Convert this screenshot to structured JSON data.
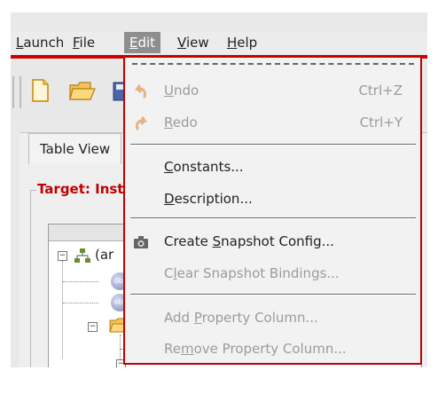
{
  "menubar": {
    "launch": "Launch",
    "file": "File",
    "edit": "Edit",
    "view": "View",
    "help": "Help"
  },
  "tabs": {
    "table_view": "Table View"
  },
  "target": {
    "title": "Target: Inst"
  },
  "tree": {
    "root_label": "(ar",
    "obj_badge": "obj"
  },
  "edit_menu": {
    "undo": {
      "label": "Undo",
      "accel": "Ctrl+Z",
      "enabled": false,
      "icon": "undo-arrow-icon"
    },
    "redo": {
      "label": "Redo",
      "accel": "Ctrl+Y",
      "enabled": false,
      "icon": "redo-arrow-icon"
    },
    "constants": {
      "label": "Constants...",
      "enabled": true
    },
    "description": {
      "label": "Description...",
      "enabled": true
    },
    "create_snapshot": {
      "label": "Create Snapshot Config...",
      "enabled": true,
      "icon": "camera-icon"
    },
    "clear_snapshot": {
      "label": "Clear Snapshot Bindings...",
      "enabled": false
    },
    "add_property_column": {
      "label": "Add Property Column...",
      "enabled": false
    },
    "remove_property_column": {
      "label": "Remove Property Column...",
      "enabled": false
    }
  },
  "colors": {
    "accent_red": "#c40000",
    "menu_bg": "#f2f2f2",
    "active_menu_bg": "#8e8e8e",
    "disabled_text": "#9b9b9b"
  }
}
